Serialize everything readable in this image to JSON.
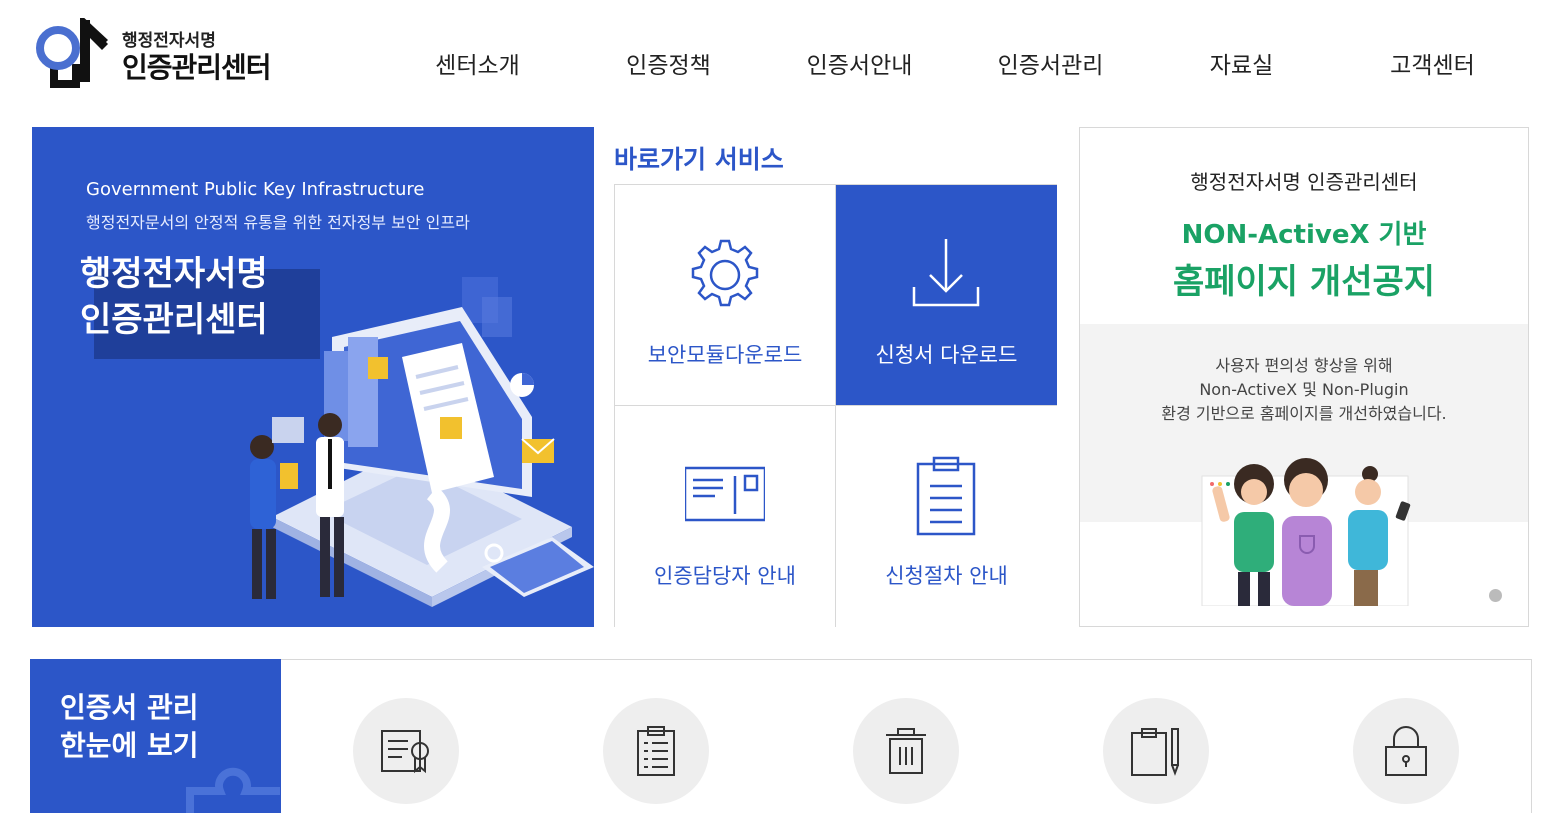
{
  "header": {
    "logo_sub": "행정전자서명",
    "logo_main": "인증관리센터",
    "nav": [
      "센터소개",
      "인증정책",
      "인증서안내",
      "인증서관리",
      "자료실",
      "고객센터"
    ]
  },
  "hero": {
    "en": "Government Public Key Infrastructure",
    "ko": "행정전자문서의 안정적 유통을 위한 전자정부 보안 인프라",
    "title_line1": "행정전자서명",
    "title_line2": "인증관리센터"
  },
  "quick": {
    "title": "바로가기 서비스",
    "items": [
      {
        "label": "보안모듈다운로드",
        "icon": "gear-icon"
      },
      {
        "label": "신청서 다운로드",
        "icon": "download-icon"
      },
      {
        "label": "인증담당자 안내",
        "icon": "mail-card-icon"
      },
      {
        "label": "신청절차 안내",
        "icon": "clipboard-icon"
      }
    ]
  },
  "notice": {
    "top": "행정전자서명 인증관리센터",
    "sub": "NON-ActiveX 기반",
    "main": "홈페이지 개선공지",
    "body_line1": "사용자 편의성 향상을 위해",
    "body_line2": "Non-ActiveX 및 Non-Plugin",
    "body_line3": "환경 기반으로 홈페이지를 개선하였습니다."
  },
  "bottom": {
    "title_line1": "인증서 관리",
    "title_line2": "한눈에 보기",
    "icons": [
      "certificate-icon",
      "checklist-icon",
      "trash-icon",
      "clipboard-pen-icon",
      "lock-icon"
    ]
  },
  "colors": {
    "primary": "#2c56c8",
    "accent_green": "#1aa265"
  }
}
